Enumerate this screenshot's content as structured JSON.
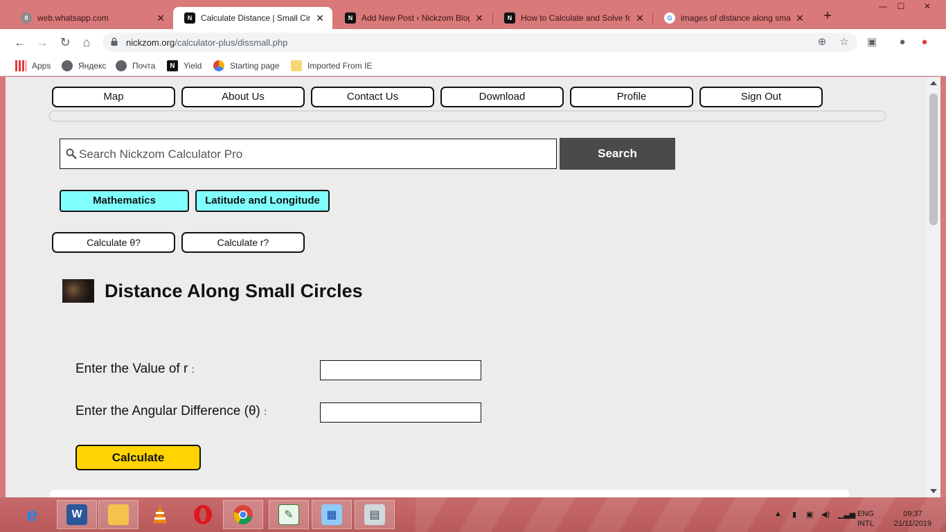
{
  "browser": {
    "tabs": [
      {
        "title": "web.whatsapp.com",
        "favicon": "whatsapp-icon",
        "active": false
      },
      {
        "title": "Calculate Distance | Small Circle",
        "favicon": "nickzom-icon",
        "active": true
      },
      {
        "title": "Add New Post ‹ Nickzom Blog —",
        "favicon": "nickzom-icon",
        "active": false
      },
      {
        "title": "How to Calculate and Solve for",
        "favicon": "nickzom-icon",
        "active": false
      },
      {
        "title": "images of distance along small",
        "favicon": "google-icon",
        "active": false
      }
    ],
    "url_domain": "nickzom.org",
    "url_path": "/calculator-plus/dissmall.php",
    "bookmarks": [
      "Apps",
      "Яндекс",
      "Почта",
      "Yield",
      "Starting page",
      "Imported From IE"
    ]
  },
  "nav": {
    "links": [
      "Map",
      "About Us",
      "Contact Us",
      "Download",
      "Profile",
      "Sign Out"
    ]
  },
  "search": {
    "placeholder": "Search Nickzom Calculator Pro",
    "button": "Search"
  },
  "categories": [
    "Mathematics",
    "Latitude and Longitude"
  ],
  "calc_links": [
    "Calculate θ?",
    "Calculate r?"
  ],
  "page": {
    "title": "Distance Along Small Circles"
  },
  "form": {
    "r_label": "Enter the Value of r",
    "theta_label": "Enter the Angular Difference (θ)",
    "colon": ":",
    "r_value": "",
    "theta_value": "",
    "calculate": "Calculate"
  },
  "taskbar": {
    "lang": "ENG",
    "layout": "INTL",
    "time": "09:37",
    "date": "21/11/2019"
  },
  "colors": {
    "frame": "#d9797a",
    "category_bg": "#80ffff",
    "search_button": "#4a4a4a",
    "calculate_button": "#ffd400"
  }
}
